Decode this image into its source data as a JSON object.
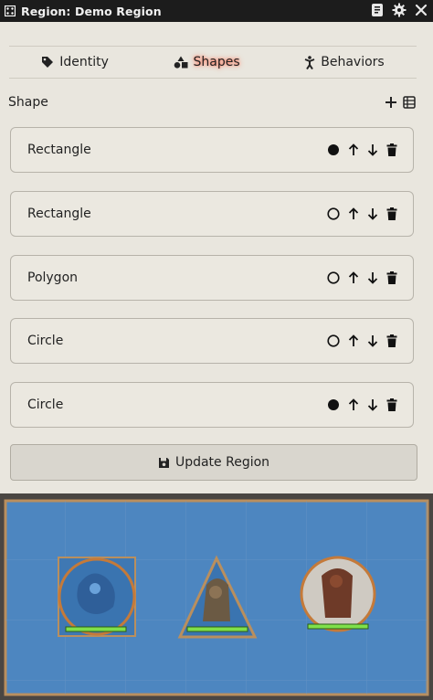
{
  "window": {
    "title": "Region: Demo Region",
    "icons": [
      "grid-icon",
      "journal-icon",
      "gear-icon",
      "close-icon"
    ]
  },
  "tabs": [
    {
      "label": "Identity",
      "icon": "tag-icon",
      "active": false
    },
    {
      "label": "Shapes",
      "icon": "shapes-icon",
      "active": true
    },
    {
      "label": "Behaviors",
      "icon": "figure-icon",
      "active": false
    }
  ],
  "shapes_section": {
    "label": "Shape",
    "tools": [
      "add-icon",
      "list-icon"
    ]
  },
  "shapes": [
    {
      "label": "Rectangle",
      "hole_filled": true
    },
    {
      "label": "Rectangle",
      "hole_filled": false
    },
    {
      "label": "Polygon",
      "hole_filled": false
    },
    {
      "label": "Circle",
      "hole_filled": false
    },
    {
      "label": "Circle",
      "hole_filled": true
    }
  ],
  "update_button": {
    "label": "Update Region",
    "icon": "save-icon"
  },
  "colors": {
    "region_fill": "#4d86c0",
    "region_border": "#b98f5e",
    "token_ring": "#c47a3a",
    "health_bar": "#7fe04a"
  }
}
